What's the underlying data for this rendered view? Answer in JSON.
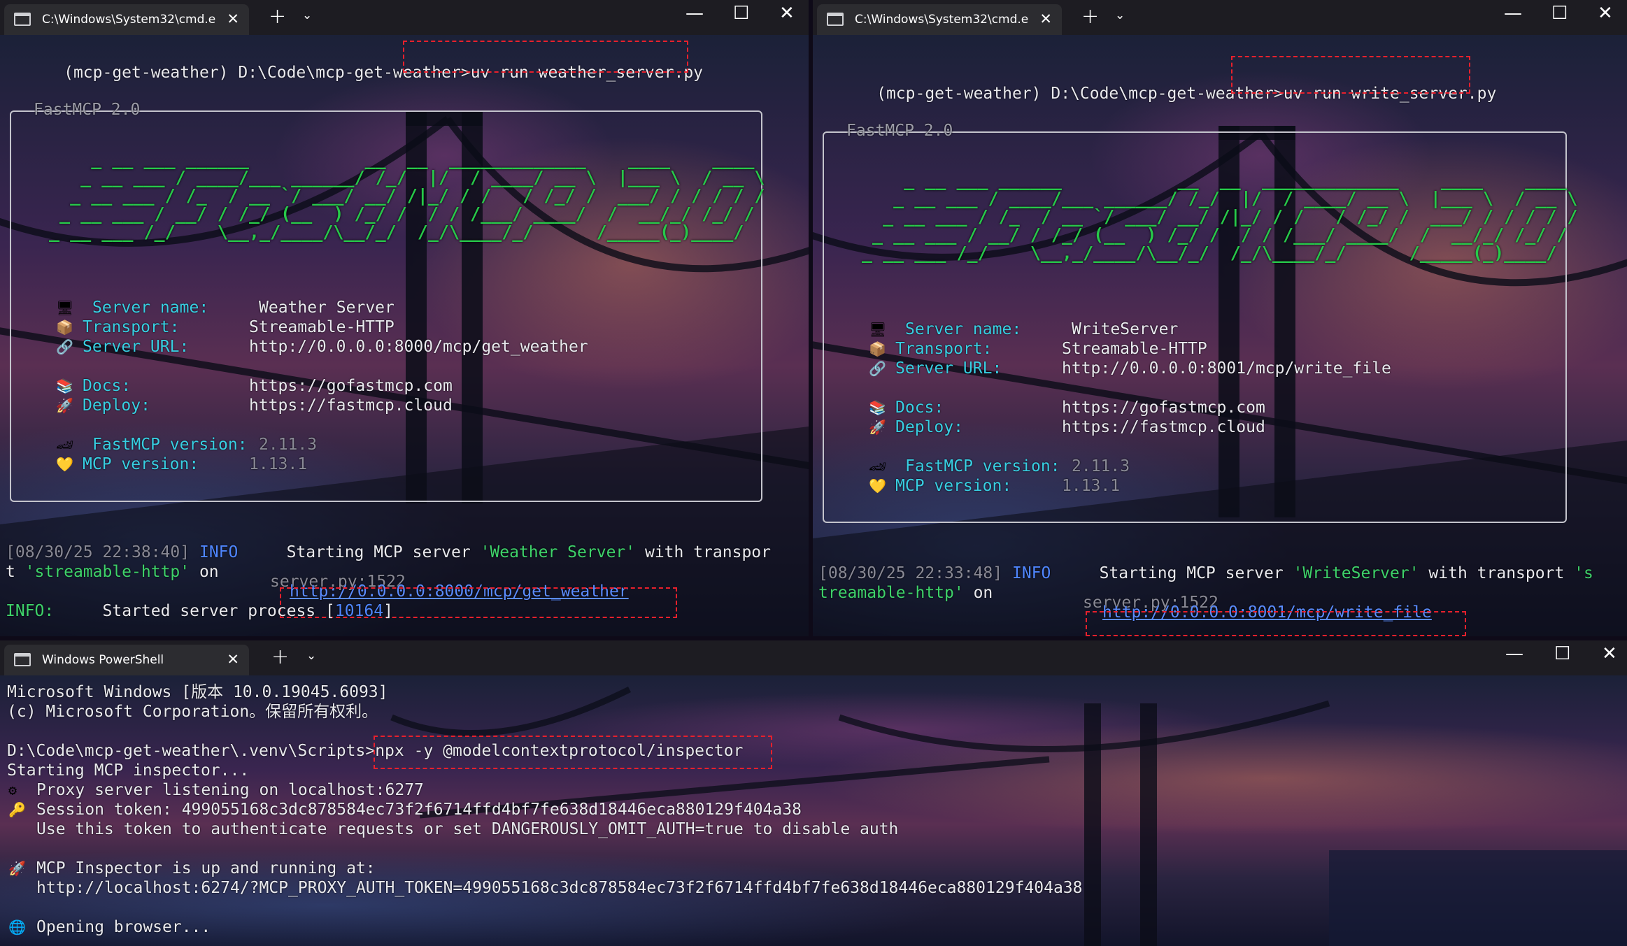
{
  "window1": {
    "tab_title": "C:\\Windows\\System32\\cmd.e>",
    "prompt": "(mcp-get-weather) D:\\Code\\mcp-get-weather>",
    "command": "uv run weather_server.py",
    "box_title": "FastMCP 2.0",
    "ascii_logo": [
      "    _ __ ___ ______           __  __  _____________    ____    ____",
      "   _ __ ___ / ____/___ ______/ /_/  |/  / ____/ __ \\  |___ \\  / __ \\",
      "  _ __ ___ / /_  / __ `/ ___/ __/ /|_/ / /   / /_/ /  ___/ / / / / /",
      " _ __ ___ / __/ / /_/ (__  ) /_/ /  / / /___/ ____/  /  __/_/ /_/ /",
      "_ __ ___ /_/    \\__,_/____/\\__/_/  /_/\\____/_/      /_____(_)____/"
    ],
    "info": {
      "server_name_label": "Server name:",
      "server_name": "Weather Server",
      "transport_label": "Transport:",
      "transport": "Streamable-HTTP",
      "server_url_label": "Server URL:",
      "server_url": "http://0.0.0.0:8000/mcp/get_weather",
      "docs_label": "Docs:",
      "docs": "https://gofastmcp.com",
      "deploy_label": "Deploy:",
      "deploy": "https://fastmcp.cloud",
      "fastmcp_version_label": "FastMCP version:",
      "fastmcp_version": "2.11.3",
      "mcp_version_label": "MCP version:",
      "mcp_version": "1.13.1"
    },
    "log": {
      "timestamp": "[08/30/25 22:38:40]",
      "level": "INFO",
      "msg_a": "Starting MCP server ",
      "msg_name": "'Weather Server'",
      "msg_b": " with transpor",
      "cont_a": "t ",
      "cont_transport": "'streamable-http'",
      "cont_b": " on",
      "source": "server.py:1522",
      "url": "http://0.0.0.0:8000/mcp/get_weather",
      "info2_label": "INFO:",
      "info2_text": "Started server process [",
      "pid": "10164",
      "info2_end": "]"
    }
  },
  "window2": {
    "tab_title": "C:\\Windows\\System32\\cmd.e>",
    "prompt": "(mcp-get-weather) D:\\Code\\mcp-get-weather>",
    "command": "uv run write_server.py",
    "box_title": "FastMCP 2.0",
    "info": {
      "server_name_label": "Server name:",
      "server_name": "WriteServer",
      "transport_label": "Transport:",
      "transport": "Streamable-HTTP",
      "server_url_label": "Server URL:",
      "server_url": "http://0.0.0.0:8001/mcp/write_file",
      "docs_label": "Docs:",
      "docs": "https://gofastmcp.com",
      "deploy_label": "Deploy:",
      "deploy": "https://fastmcp.cloud",
      "fastmcp_version_label": "FastMCP version:",
      "fastmcp_version": "2.11.3",
      "mcp_version_label": "MCP version:",
      "mcp_version": "1.13.1"
    },
    "log": {
      "timestamp": "[08/30/25 22:33:48]",
      "level": "INFO",
      "msg_a": "Starting MCP server ",
      "msg_name": "'WriteServer'",
      "msg_b": " with transport ",
      "msg_c": "'s",
      "cont_transport": "treamable-http'",
      "cont_b": " on",
      "source": "server.py:1522",
      "url": "http://0.0.0.0:8001/mcp/write_file"
    }
  },
  "window3": {
    "tab_title": "Windows PowerShell",
    "lines": {
      "l1": "Microsoft Windows [版本 10.0.19045.6093]",
      "l2": "(c) Microsoft Corporation。保留所有权利。",
      "prompt": "D:\\Code\\mcp-get-weather\\.venv\\Scripts>",
      "command": "npx -y @modelcontextprotocol/inspector",
      "l4": "Starting MCP inspector...",
      "l5": "Proxy server listening on localhost:6277",
      "l6": "Session token: 499055168c3dc878584ec73f2f6714ffd4bf7fe638d18446eca880129f404a38",
      "l7": "Use this token to authenticate requests or set DANGEROUSLY_OMIT_AUTH=true to disable auth",
      "l8": "MCP Inspector is up and running at:",
      "l9": "http://localhost:6274/?MCP_PROXY_AUTH_TOKEN=499055168c3dc878584ec73f2f6714ffd4bf7fe638d18446eca880129f404a38",
      "l10": "Opening browser..."
    }
  },
  "window_controls": {
    "minimize": "—",
    "maximize": "☐",
    "close": "✕",
    "new_tab": "+",
    "dropdown": "⌄",
    "tab_close": "✕"
  },
  "icons": {
    "server": "🖥",
    "transport": "📦",
    "url": "🔗",
    "docs": "📚",
    "deploy": "🚀",
    "version": "🏎",
    "heart": "💛",
    "gear": "⚙",
    "key": "🔑",
    "rocket": "🚀",
    "globe": "🌐"
  },
  "colors": {
    "ascii": "#27c94a",
    "label": "#38cfe3",
    "info_level": "#4f86ff",
    "highlight": "#e8202c"
  }
}
